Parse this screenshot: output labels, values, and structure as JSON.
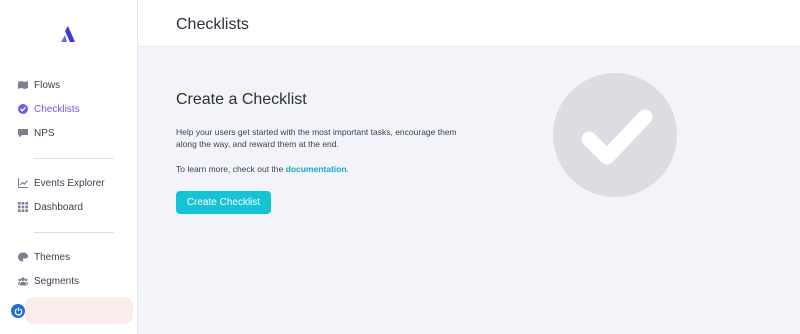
{
  "app": {
    "page_title": "Checklists"
  },
  "sidebar": {
    "items": [
      {
        "label": "Flows",
        "icon": "map-icon",
        "active": false
      },
      {
        "label": "Checklists",
        "icon": "check-circle-icon",
        "active": true
      },
      {
        "label": "NPS",
        "icon": "chat-icon",
        "active": false
      },
      {
        "label": "Events Explorer",
        "icon": "chart-icon",
        "active": false
      },
      {
        "label": "Dashboard",
        "icon": "grid-icon",
        "active": false
      },
      {
        "label": "Themes",
        "icon": "palette-icon",
        "active": false
      },
      {
        "label": "Segments",
        "icon": "users-icon",
        "active": false
      }
    ]
  },
  "main": {
    "title": "Create a Checklist",
    "description": "Help your users get started with the most important tasks, encourage them along the way, and reward them at the end.",
    "learn_prefix": "To learn more, check out the ",
    "learn_link": "documentation",
    "learn_suffix": ".",
    "cta_label": "Create Checklist"
  },
  "colors": {
    "accent": "#6c5ce7",
    "cta": "#14c3d4",
    "link": "#19a7c7"
  }
}
